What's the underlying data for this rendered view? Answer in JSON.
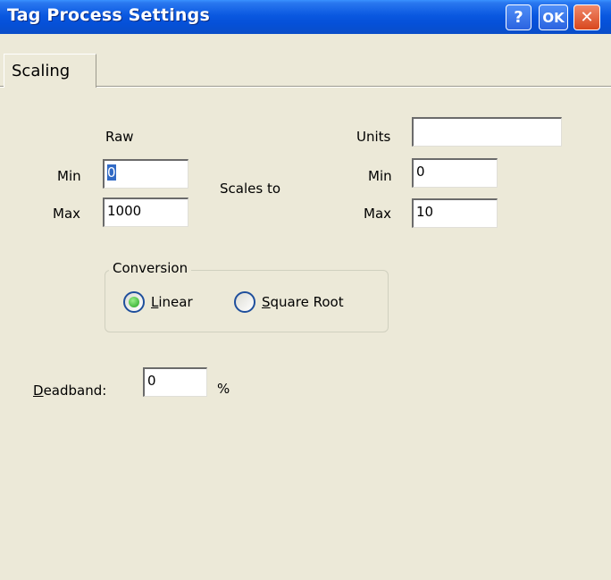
{
  "window": {
    "title": "Tag Process Settings",
    "help_label": "?",
    "ok_label": "OK",
    "close_label": "✕"
  },
  "tabs": [
    {
      "label": "Scaling"
    }
  ],
  "raw": {
    "header": "Raw",
    "min_label": "Min",
    "min_value": "0",
    "max_label": "Max",
    "max_value": "1000"
  },
  "scales_to_label": "Scales to",
  "units": {
    "label": "Units",
    "value": "",
    "min_label": "Min",
    "min_value": "0",
    "max_label": "Max",
    "max_value": "10"
  },
  "conversion": {
    "legend": "Conversion",
    "options": [
      {
        "accel": "L",
        "rest": "inear",
        "checked": true
      },
      {
        "accel": "S",
        "rest": "quare Root",
        "checked": false
      }
    ]
  },
  "deadband": {
    "accel": "D",
    "rest": "eadband:",
    "value": "0",
    "unit": "%"
  }
}
